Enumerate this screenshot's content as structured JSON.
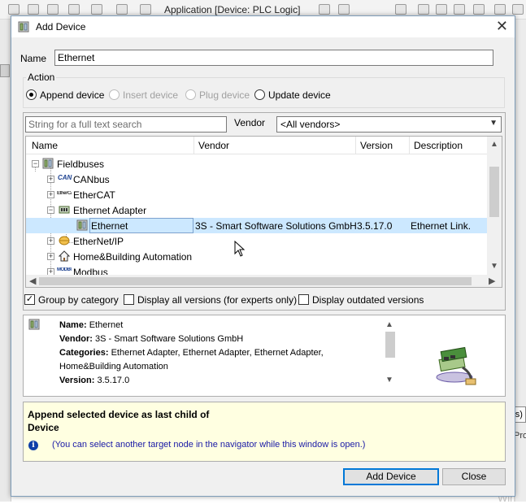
{
  "background": {
    "toolbar_text": "Application [Device: PLC Logic]",
    "right_box_text": "(s)",
    "right_text": "Pro",
    "right_ghost_text": "Win"
  },
  "dialog": {
    "title": "Add Device",
    "close_glyph": "✕",
    "name_label": "Name",
    "name_value": "Ethernet",
    "action_label": "Action",
    "actions": [
      {
        "label": "Append device",
        "selected": true,
        "enabled": true
      },
      {
        "label": "Insert device",
        "selected": false,
        "enabled": false
      },
      {
        "label": "Plug device",
        "selected": false,
        "enabled": false
      },
      {
        "label": "Update device",
        "selected": false,
        "enabled": true
      }
    ],
    "search_placeholder": "String for a full text search",
    "vendor_label": "Vendor",
    "vendor_value": "<All vendors>",
    "tree_columns": [
      "Name",
      "Vendor",
      "Version",
      "Description"
    ],
    "tree_rows": [
      {
        "name": "Fieldbuses",
        "vendor": "",
        "version": "",
        "description": "",
        "icon": "fieldbus-icon",
        "expander": "−"
      },
      {
        "name": "CANbus",
        "vendor": "",
        "version": "",
        "description": "",
        "icon": "canbus-icon",
        "icon_text": "CAN",
        "expander": "+"
      },
      {
        "name": "EtherCAT",
        "vendor": "",
        "version": "",
        "description": "",
        "icon": "ethercat-icon",
        "icon_text": "EtherCAT",
        "expander": "+"
      },
      {
        "name": "Ethernet Adapter",
        "vendor": "",
        "version": "",
        "description": "",
        "icon": "ethernet-adapter-icon",
        "expander": "−"
      },
      {
        "name": "Ethernet",
        "vendor": "3S - Smart Software Solutions GmbH",
        "version": "3.5.17.0",
        "description": "Ethernet Link.",
        "icon": "device-icon",
        "selected": true
      },
      {
        "name": "EtherNet/IP",
        "vendor": "",
        "version": "",
        "description": "",
        "icon": "ethernet-ip-icon",
        "expander": "+"
      },
      {
        "name": "Home&Building Automation",
        "vendor": "",
        "version": "",
        "description": "",
        "icon": "home-icon",
        "expander": "+"
      },
      {
        "name": "Modbus",
        "vendor": "",
        "version": "",
        "description": "",
        "icon": "modbus-icon",
        "icon_text": "MODBUS",
        "expander": "+"
      }
    ],
    "options": [
      {
        "label": "Group by category",
        "checked": true
      },
      {
        "label": "Display all versions (for experts only)",
        "checked": false
      },
      {
        "label": "Display outdated versions",
        "checked": false
      }
    ],
    "info": {
      "name_label": "Name:",
      "name": "Ethernet",
      "vendor_label": "Vendor:",
      "vendor": "3S - Smart Software Solutions GmbH",
      "categories_label": "Categories:",
      "categories_line1": "Ethernet Adapter, Ethernet Adapter, Ethernet Adapter,",
      "categories_line2": "Home&Building Automation",
      "version_label": "Version:",
      "version": "3.5.17.0"
    },
    "hint": {
      "title": "Append selected device as last child of Device",
      "info_glyph": "i",
      "text": "(You can select another target node in the navigator while this window is open.)"
    },
    "buttons": {
      "add": "Add Device",
      "close": "Close"
    },
    "colors": {
      "selection": "#cce8ff",
      "hint_background": "#ffffe1",
      "hint_text": "#1a1aa6",
      "default_button_border": "#0078d7"
    }
  }
}
